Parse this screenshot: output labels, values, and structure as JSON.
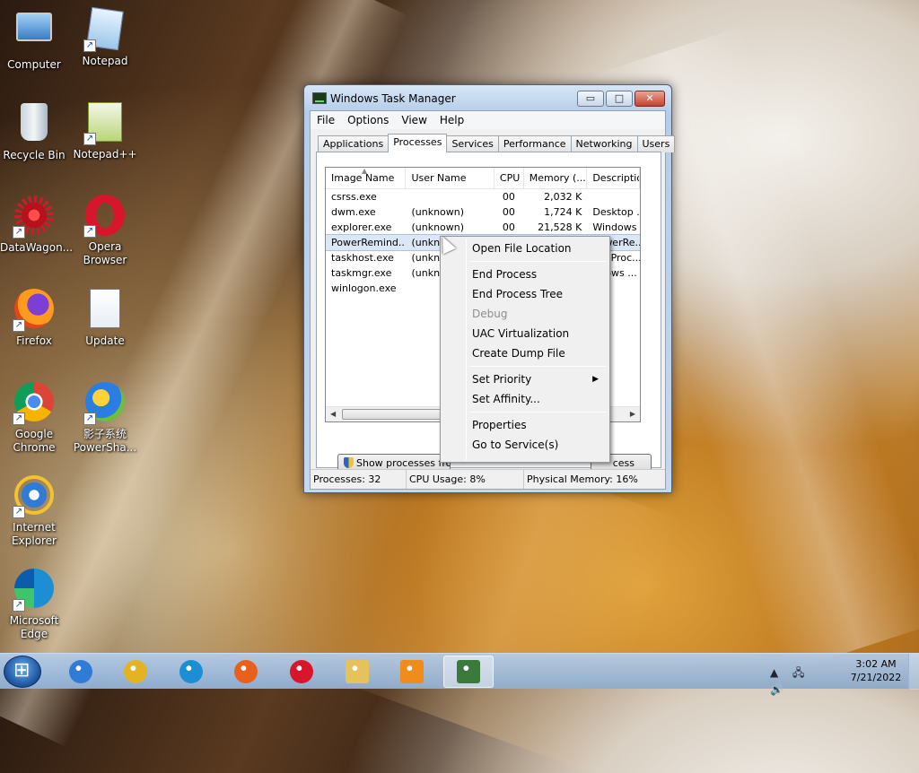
{
  "desktop": {
    "icons": [
      {
        "label": "Computer",
        "icon": "computer-icon",
        "shortcut": false
      },
      {
        "label": "Notepad",
        "icon": "notepad-icon",
        "shortcut": true
      },
      {
        "label": "Recycle Bin",
        "icon": "recycle-bin-icon",
        "shortcut": false
      },
      {
        "label": "Notepad++",
        "icon": "notepad-plus-plus-icon",
        "shortcut": true
      },
      {
        "label": "DataWagon...",
        "icon": "datawagon-icon",
        "shortcut": true
      },
      {
        "label": "Opera Browser",
        "icon": "opera-icon",
        "shortcut": true
      },
      {
        "label": "Firefox",
        "icon": "firefox-icon",
        "shortcut": true
      },
      {
        "label": "Update",
        "icon": "script-file-icon",
        "shortcut": false
      },
      {
        "label": "Google Chrome",
        "icon": "chrome-icon",
        "shortcut": true
      },
      {
        "label": "影子系统 PowerSha...",
        "icon": "powershadow-icon",
        "shortcut": true
      },
      {
        "label": "Internet Explorer",
        "icon": "internet-explorer-icon",
        "shortcut": true
      },
      {
        "label": "Microsoft Edge",
        "icon": "edge-icon",
        "shortcut": true
      }
    ]
  },
  "task_manager": {
    "title": "Windows Task Manager",
    "buttons": {
      "minimize": "▭",
      "maximize": "□",
      "close": "✕"
    },
    "menu": [
      "File",
      "Options",
      "View",
      "Help"
    ],
    "tabs": [
      "Applications",
      "Processes",
      "Services",
      "Performance",
      "Networking",
      "Users"
    ],
    "active_tab": "Processes",
    "columns": [
      "Image Name",
      "User Name",
      "CPU",
      "Memory (...",
      "Description"
    ],
    "rows": [
      {
        "image": "csrss.exe",
        "user": "",
        "cpu": "00",
        "memory": "2,032 K",
        "desc": ""
      },
      {
        "image": "dwm.exe",
        "user": "(unknown)",
        "cpu": "00",
        "memory": "1,724 K",
        "desc": "Desktop ..."
      },
      {
        "image": "explorer.exe",
        "user": "(unknown)",
        "cpu": "00",
        "memory": "21,528 K",
        "desc": "Windows ..."
      },
      {
        "image": "PowerRemind...",
        "user": "(unkn",
        "cpu": "",
        "memory": "",
        "desc": "PowerRe..."
      },
      {
        "image": "taskhost.exe",
        "user": "(unkn",
        "cpu": "",
        "memory": "",
        "desc": "ost Proc..."
      },
      {
        "image": "taskmgr.exe",
        "user": "(unkn",
        "cpu": "",
        "memory": "",
        "desc": "ndows ..."
      },
      {
        "image": "winlogon.exe",
        "user": "",
        "cpu": "",
        "memory": "",
        "desc": ""
      }
    ],
    "selected_row": 3,
    "show_processes_button": "Show processes fro",
    "end_process_button": "cess",
    "status": {
      "processes": "Processes: 32",
      "cpu": "CPU Usage: 8%",
      "memory": "Physical Memory: 16%"
    }
  },
  "context_menu": {
    "groups": [
      [
        {
          "label": "Open File Location",
          "enabled": true
        }
      ],
      [
        {
          "label": "End Process",
          "enabled": true
        },
        {
          "label": "End Process Tree",
          "enabled": true
        },
        {
          "label": "Debug",
          "enabled": false
        },
        {
          "label": "UAC Virtualization",
          "enabled": true
        },
        {
          "label": "Create Dump File",
          "enabled": true
        }
      ],
      [
        {
          "label": "Set Priority",
          "enabled": true,
          "submenu": true
        },
        {
          "label": "Set Affinity...",
          "enabled": true
        }
      ],
      [
        {
          "label": "Properties",
          "enabled": true
        },
        {
          "label": "Go to Service(s)",
          "enabled": true
        }
      ]
    ]
  },
  "taskbar": {
    "pinned": [
      {
        "name": "internet-explorer-icon",
        "color": "#2f7bd6"
      },
      {
        "name": "chrome-icon",
        "color": "#e3b322"
      },
      {
        "name": "edge-icon",
        "color": "#1c8fd4"
      },
      {
        "name": "firefox-icon",
        "color": "#e8601c"
      },
      {
        "name": "opera-icon",
        "color": "#d8152a"
      },
      {
        "name": "file-explorer-icon",
        "color": "#e6c25a"
      },
      {
        "name": "media-player-icon",
        "color": "#f08c1c"
      },
      {
        "name": "task-manager-icon",
        "color": "#3a7a3a"
      }
    ],
    "active_index": 7,
    "clock_time": "3:02 AM",
    "clock_date": "7/21/2022",
    "tray_icons": "▲ 🖧 🔊"
  }
}
